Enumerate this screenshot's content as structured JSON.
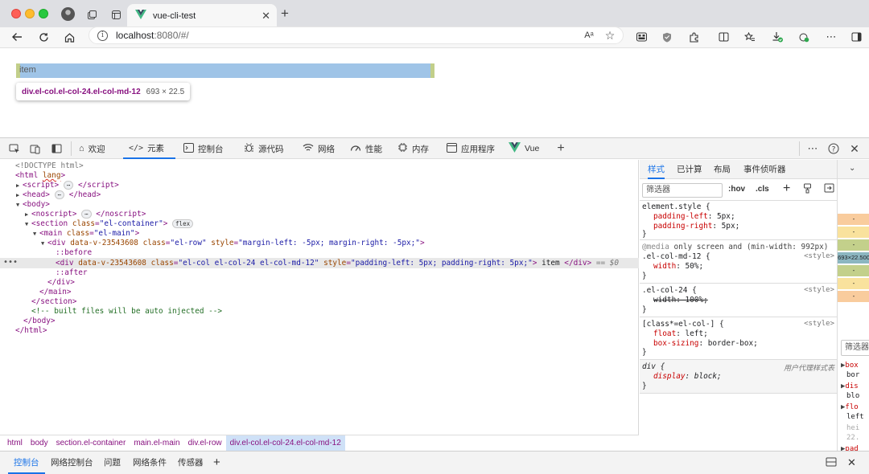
{
  "browser": {
    "tab_title": "vue-cli-test",
    "url_host": "localhost",
    "url_rest": ":8080/#/"
  },
  "page": {
    "item_text": "item",
    "tooltip_selector": "div.el-col.el-col-24.el-col-md-12",
    "tooltip_size": "693 × 22.5"
  },
  "devtools": {
    "tabs": [
      "欢迎",
      "元素",
      "控制台",
      "源代码",
      "网络",
      "性能",
      "内存",
      "应用程序",
      "Vue"
    ],
    "active_tab": "元素",
    "dom": [
      "<!DOCTYPE html>",
      "<html lang>",
      "<script>",
      "<head>",
      "<body>",
      "<noscript>",
      "<section class=\"el-container\">",
      "<main class=\"el-main\">",
      "<div data-v-23543608 class=\"el-row\" style=\"margin-left: -5px; margin-right: -5px;\">",
      "::before",
      "<div data-v-23543608 class=\"el-col el-col-24 el-col-md-12\" style=\"padding-left: 5px; padding-right: 5px;\"> item </div> == $0",
      "::after",
      "</div>",
      "</main>",
      "</section>",
      "<!-- built files will be auto injected -->",
      "</body>",
      "</html>"
    ],
    "flex_badge": "flex",
    "breadcrumbs": [
      "html",
      "body",
      "section.el-container",
      "main.el-main",
      "div.el-row",
      "div.el-col.el-col-24.el-col-md-12"
    ],
    "styles_tabs": [
      "样式",
      "已计算",
      "布局",
      "事件侦听器"
    ],
    "filter_placeholder": "筛选器",
    "hov": ":hov",
    "cls": ".cls",
    "rules": {
      "element_style": "element.style {",
      "pad_left": "padding-left: 5px;",
      "pad_right": "padding-right: 5px;",
      "media": "@media only screen and (min-width: 992px)",
      "md12_selector": ".el-col-md-12 {",
      "md12_width": "width: 50%;",
      "col24_selector": ".el-col-24 {",
      "col24_width": "width: 100%;",
      "attr_selector": "[class*=el-col-] {",
      "float": "float: left;",
      "box_sizing": "box-sizing: border-box;",
      "div_selector": "div {",
      "display": "display: block;",
      "close": "}",
      "src_style": "<style>",
      "src_ua": "用户代理样式表"
    },
    "boxmodel_size": "693×22.500",
    "computed_filter": "筛选器",
    "computed": [
      "box",
      "bor",
      "dis",
      "blo",
      "flo",
      "left",
      "hei",
      "22.",
      "pad"
    ],
    "drawer_tabs": [
      "控制台",
      "网络控制台",
      "问题",
      "网络条件",
      "传感器"
    ]
  },
  "colors": {
    "margin": "#f9cc9d",
    "padding": "#c3d08b",
    "content": "#8cb6c0",
    "highlight": "#9fc4e7",
    "accent": "#1a73e8"
  }
}
